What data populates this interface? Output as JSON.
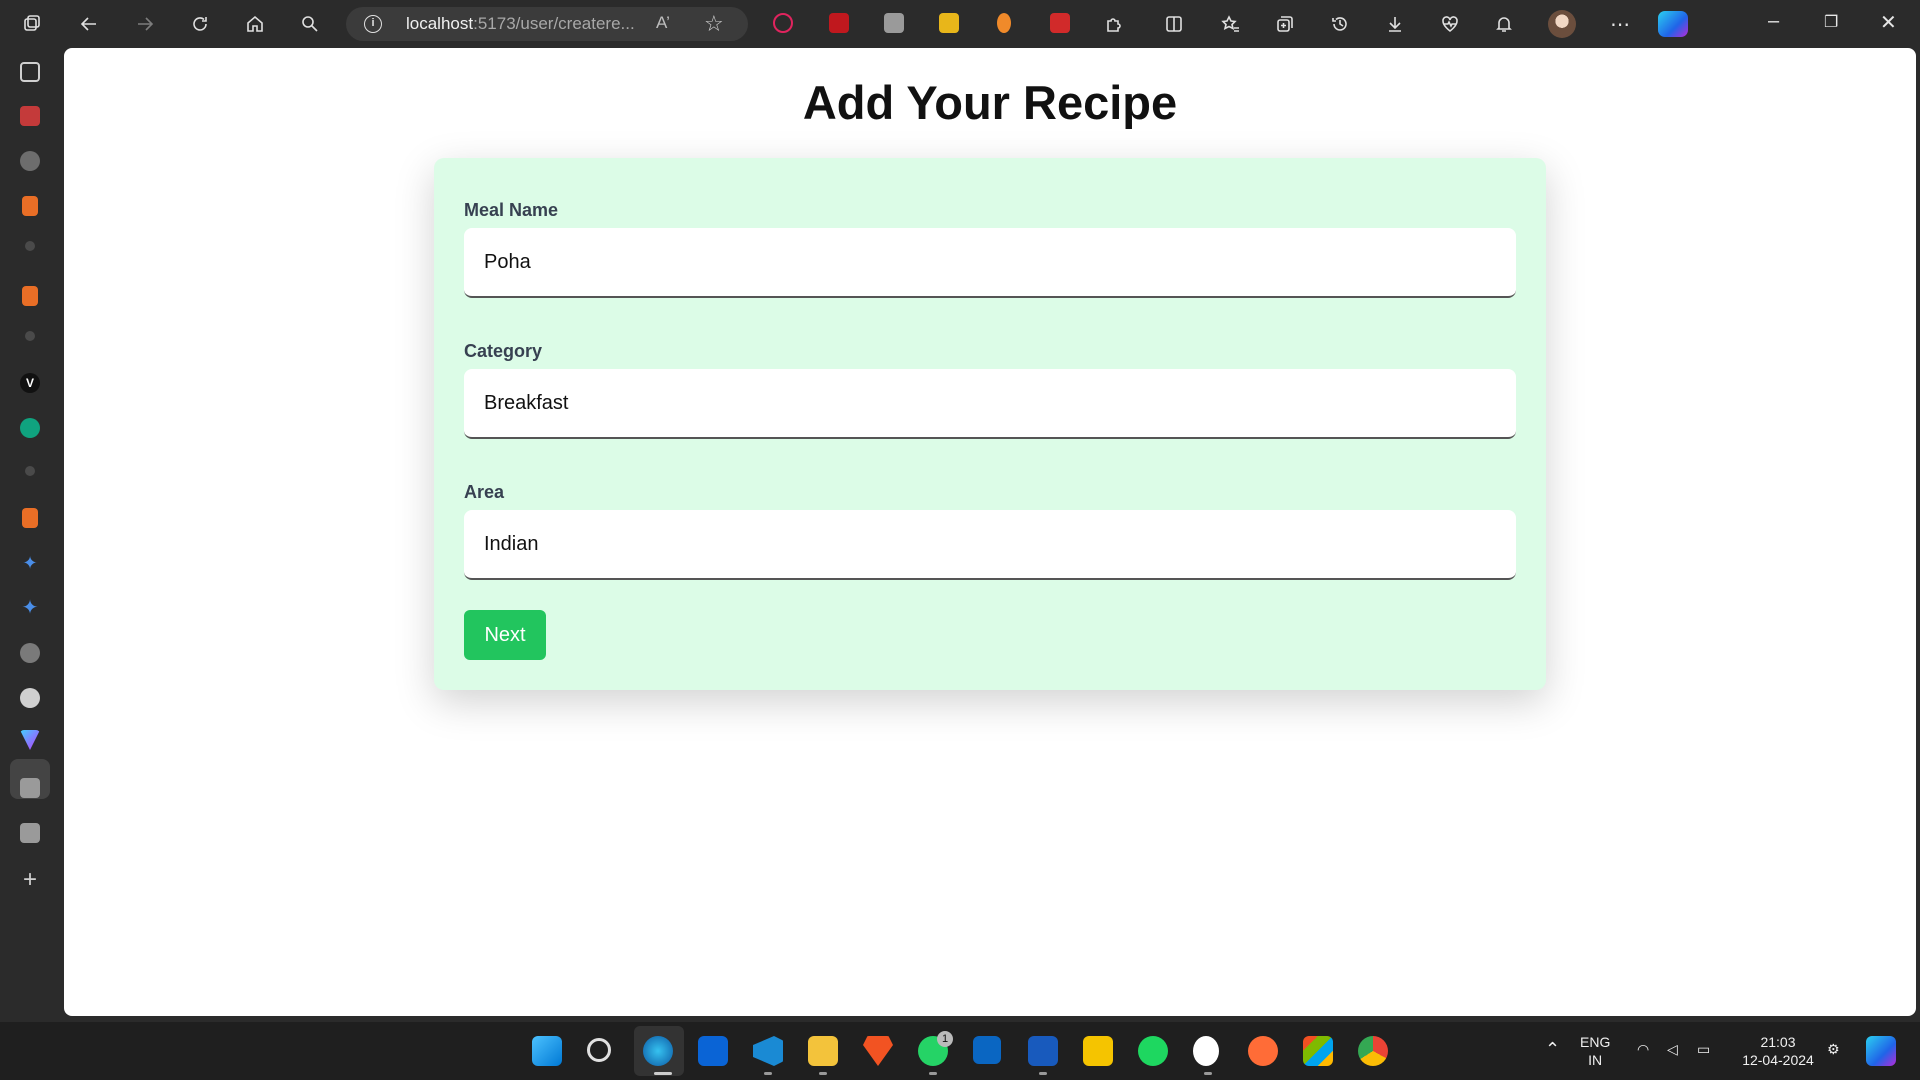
{
  "browser": {
    "url_host": "localhost",
    "url_rest": ":5173/user/createre..."
  },
  "page": {
    "title": "Add Your Recipe"
  },
  "form": {
    "meal_name_label": "Meal Name",
    "meal_name_value": "Poha",
    "category_label": "Category",
    "category_value": "Breakfast",
    "area_label": "Area",
    "area_value": "Indian",
    "next_label": "Next"
  },
  "taskbar": {
    "whatsapp_badge": "1",
    "lang_line1": "ENG",
    "lang_line2": "IN",
    "time": "21:03",
    "date": "12-04-2024"
  },
  "colors": {
    "card_bg": "#dcfce7",
    "button_bg": "#22c55e"
  }
}
